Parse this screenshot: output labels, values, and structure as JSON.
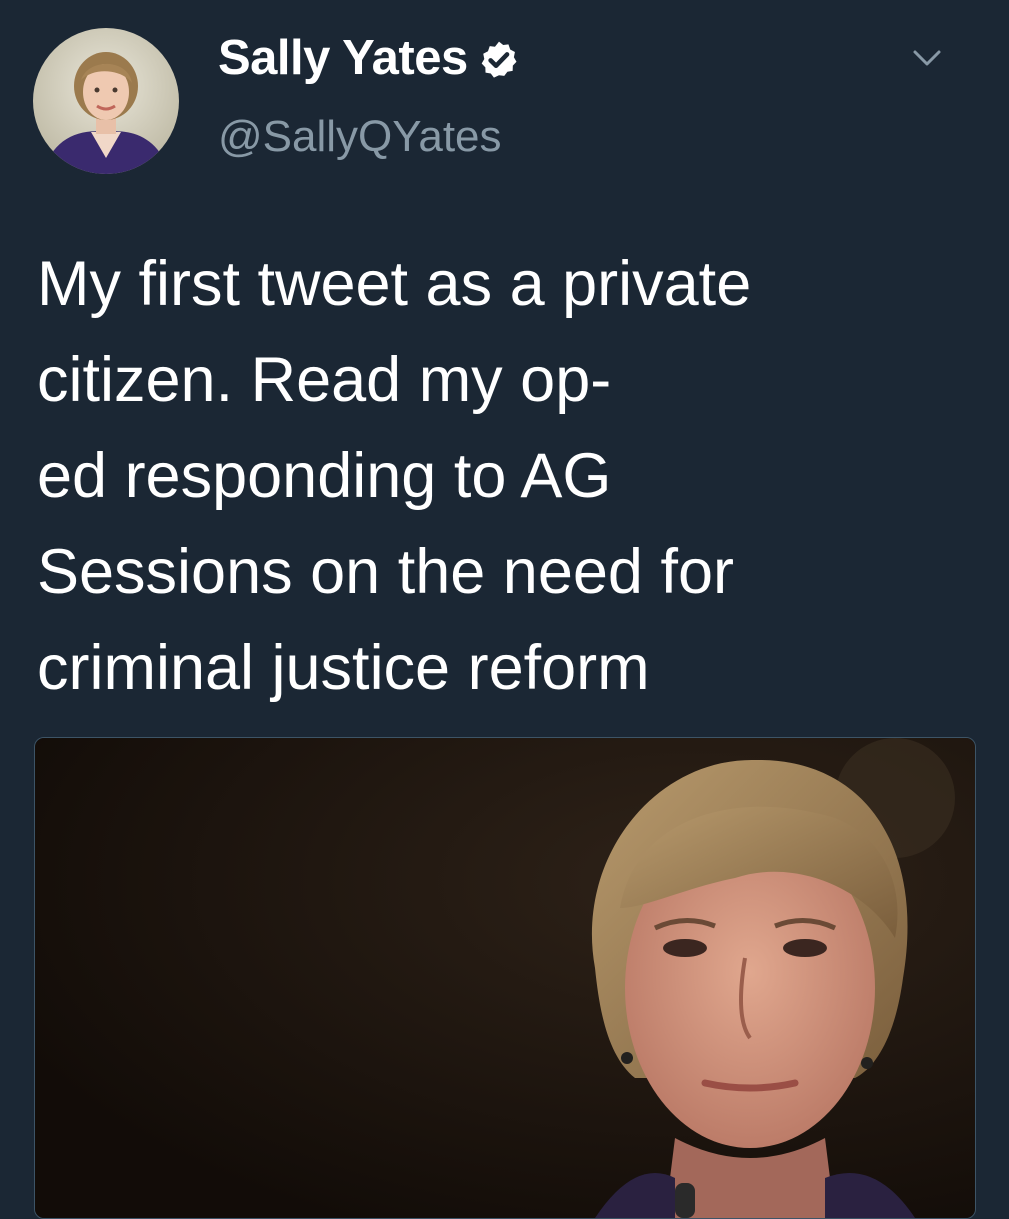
{
  "author": {
    "display_name": "Sally Yates",
    "handle": "@SallyQYates",
    "verified": true,
    "avatar_icon": "avatar-photo",
    "verified_icon": "verified-badge-icon"
  },
  "menu": {
    "icon": "chevron-down-icon"
  },
  "tweet": {
    "text": "My first tweet as a private\ncitizen. Read my op-\ned responding to AG\nSessions on the need for\ncriminal justice reform"
  },
  "media": {
    "kind": "photo"
  },
  "colors": {
    "background": "#1b2734",
    "text": "#ffffff",
    "secondary_text": "#8899a6",
    "verified_fill": "#ffffff"
  }
}
